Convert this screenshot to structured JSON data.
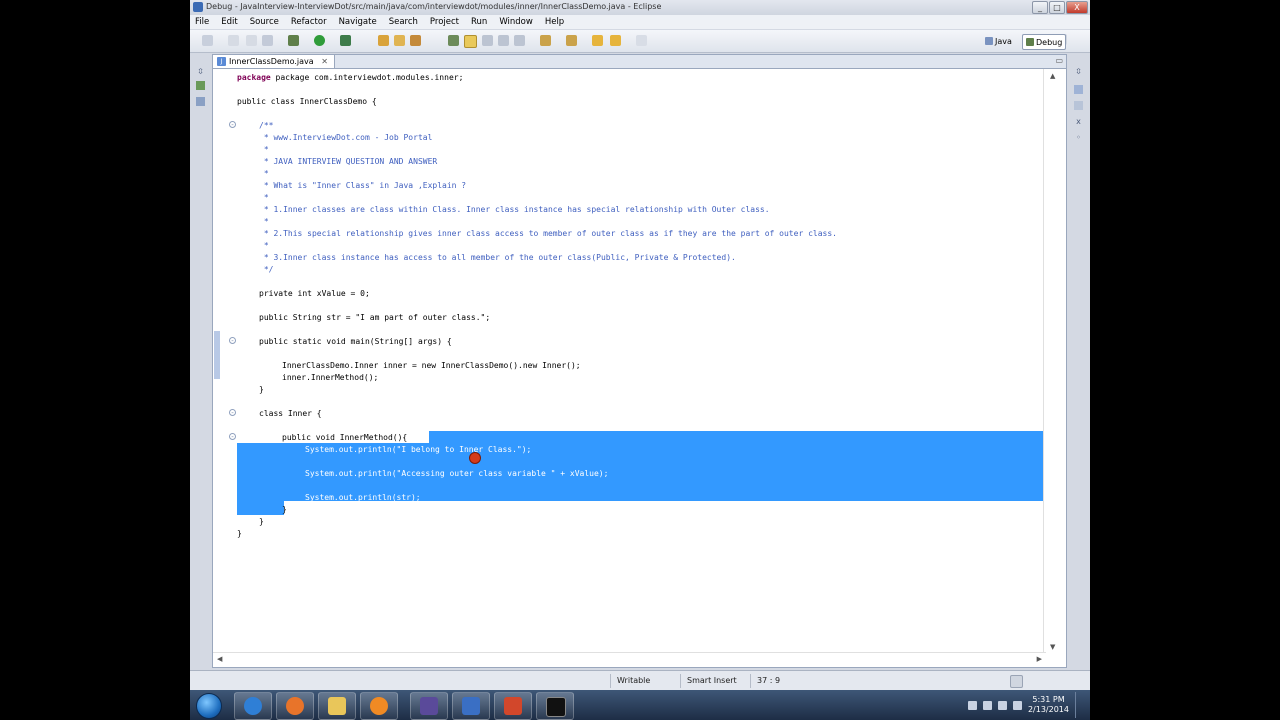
{
  "window": {
    "title": "Debug - JavaInterview-InterviewDot/src/main/java/com/interviewdot/modules/inner/InnerClassDemo.java - Eclipse",
    "buttons": [
      "_",
      "□",
      "X"
    ]
  },
  "menu": [
    "File",
    "Edit",
    "Source",
    "Refactor",
    "Navigate",
    "Search",
    "Project",
    "Run",
    "Window",
    "Help"
  ],
  "perspectives": {
    "java": "Java",
    "debug": "Debug"
  },
  "editor": {
    "tab_label": "InnerClassDemo.java",
    "tab_close": "✕",
    "lines": [
      "package com.interviewdot.modules.inner;",
      "public class InnerClassDemo {",
      "/**",
      " * www.InterviewDot.com - Job Portal",
      " *",
      " * JAVA INTERVIEW QUESTION AND ANSWER",
      " *",
      " * What is \"Inner Class\" in Java ,Explain ?",
      " *",
      " * 1.Inner classes are class within Class. Inner class instance has special relationship with Outer class.",
      " *",
      " * 2.This special relationship gives inner class access to member of outer class as if they are the part of outer class.",
      " *",
      " * 3.Inner class instance has access to all member of the outer class(Public, Private & Protected).",
      " */",
      "private int xValue = 0;",
      "public String str = \"I am part of outer class.\";",
      "public static void main(String[] args) {",
      "InnerClassDemo.Inner inner = new InnerClassDemo().new Inner();",
      "inner.InnerMethod();",
      "}",
      "class Inner {",
      "public void InnerMethod(){",
      "System.out.println(\"I belong to Inner Class.\");",
      "System.out.println(\"Accessing outer class variable \" + xValue);",
      "System.out.println(str);",
      "}",
      "}",
      "}"
    ]
  },
  "status": {
    "writable": "Writable",
    "insert_mode": "Smart Insert",
    "position": "37 : 9"
  },
  "taskbar": {
    "time": "5:31 PM",
    "date": "2/13/2014"
  }
}
